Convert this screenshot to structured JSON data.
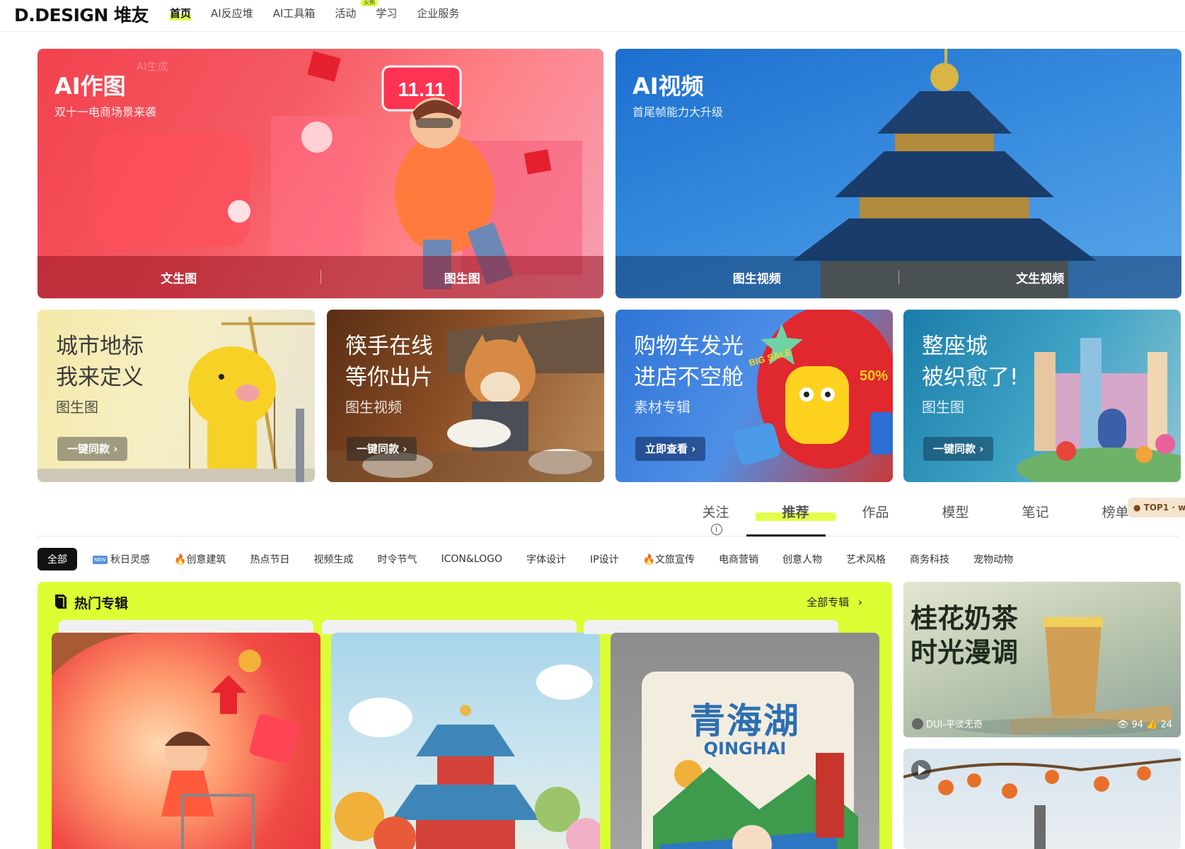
{
  "header": {
    "logo": "D.DESIGN 堆友",
    "nav": [
      {
        "label": "首页"
      },
      {
        "label": "AI反应堆"
      },
      {
        "label": "AI工具箱"
      },
      {
        "label": "活动"
      },
      {
        "label": "学习"
      },
      {
        "label": "企业服务"
      }
    ],
    "activity_badge": "火热"
  },
  "banners": [
    {
      "title": "AI作图",
      "subtitle": "双十一电商场景来袭",
      "left_action": "文生图",
      "right_action": "图生图",
      "watermark": "AI生成",
      "sign": "11.11"
    },
    {
      "title": "AI视频",
      "subtitle": "首尾帧能力大升级",
      "left_action": "图生视频",
      "right_action": "文生视频"
    }
  ],
  "cards": [
    {
      "line1": "城市地标",
      "line2": "我来定义",
      "sub": "图生图",
      "button": "一键同款"
    },
    {
      "line1": "筷手在线",
      "line2": "等你出片",
      "sub": "图生视频",
      "button": "一键同款"
    },
    {
      "line1": "购物车发光",
      "line2": "进店不空舱",
      "sub": "素材专辑",
      "button": "立即查看",
      "sticker1": "BIG SALE",
      "sticker2": "50%"
    },
    {
      "line1": "整座城",
      "line2": "被织愈了!",
      "sub": "图生图",
      "button": "一键同款"
    }
  ],
  "tabs": [
    {
      "label": "关注"
    },
    {
      "label": "推荐"
    },
    {
      "label": "作品"
    },
    {
      "label": "模型"
    },
    {
      "label": "笔记"
    },
    {
      "label": "榜单"
    }
  ],
  "top1_badge": "TOP1 · w",
  "categories": [
    {
      "label": "全部"
    },
    {
      "label": "秋日灵感",
      "icon": "new-icon",
      "badge": "NEW"
    },
    {
      "label": "创意建筑",
      "icon": "fire-icon"
    },
    {
      "label": "热点节日"
    },
    {
      "label": "视频生成"
    },
    {
      "label": "时令节气"
    },
    {
      "label": "ICON&LOGO"
    },
    {
      "label": "字体设计"
    },
    {
      "label": "IP设计"
    },
    {
      "label": "文旅宣传",
      "icon": "fire-icon"
    },
    {
      "label": "电商营销"
    },
    {
      "label": "创意人物"
    },
    {
      "label": "艺术风格"
    },
    {
      "label": "商务科技"
    },
    {
      "label": "宠物动物"
    }
  ],
  "hot_albums": {
    "title": "热门专辑",
    "all_label": "全部专辑",
    "qinghai_cn": "青海湖",
    "qinghai_en": "QINGHAI"
  },
  "posts": [
    {
      "title_line1": "桂花奶茶",
      "title_line2": "时光漫调",
      "author": "DUI-平淡无奇",
      "views": "94",
      "likes": "24"
    }
  ],
  "colors": {
    "accent": "#dcff34",
    "red_banner": "#e8404a",
    "blue_banner": "#2f86d6"
  }
}
